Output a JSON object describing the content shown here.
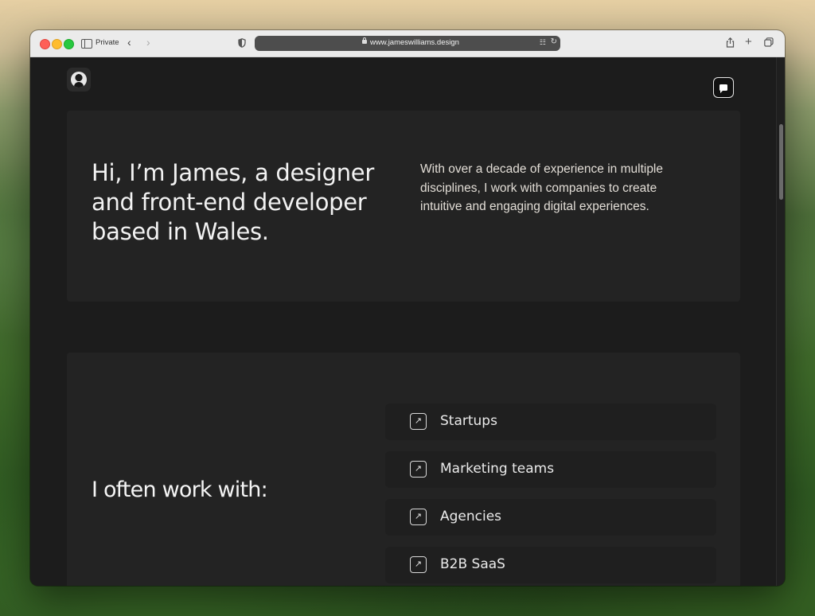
{
  "browser": {
    "mode_label": "Private",
    "url": "www.jameswilliams.design",
    "icons": {
      "sidebar": "sidebar-icon",
      "back": "chevron-left-icon",
      "forward": "chevron-right-icon",
      "privacy": "shield-icon",
      "lock": "lock-icon",
      "translate": "translate-icon",
      "reload": "reload-icon",
      "share": "share-icon",
      "new_tab": "plus-icon",
      "tabs": "tabs-overview-icon"
    }
  },
  "page": {
    "avatar_icon": "avatar",
    "chat_icon": "chat-bubble-icon",
    "hero": {
      "title": "Hi, I’m James, a designer and front-end developer based in Wales.",
      "description": "With over a decade of experience in multiple disciplines, I work with companies to create intuitive and engaging digital experiences."
    },
    "work": {
      "heading": "I often work with:",
      "items": [
        {
          "label": "Startups",
          "icon": "arrow-up-right-icon"
        },
        {
          "label": "Marketing teams",
          "icon": "arrow-up-right-icon"
        },
        {
          "label": "Agencies",
          "icon": "arrow-up-right-icon"
        },
        {
          "label": "B2B SaaS",
          "icon": "arrow-up-right-icon"
        }
      ]
    }
  },
  "colors": {
    "page_bg": "#1c1c1c",
    "card_bg": "#232323",
    "text_primary": "#f2f2f2"
  }
}
